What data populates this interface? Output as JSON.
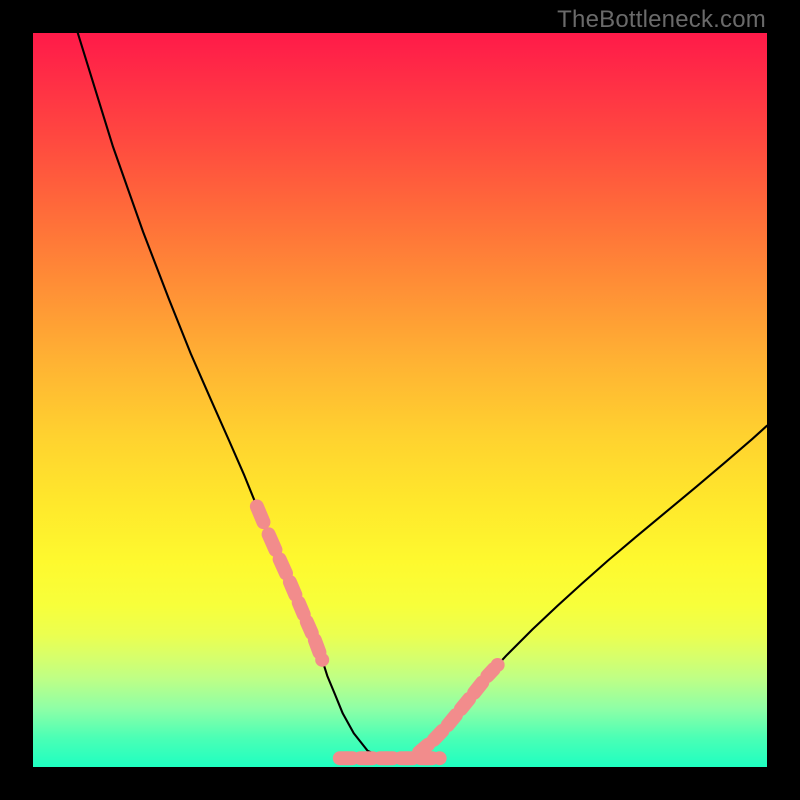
{
  "watermark": {
    "text": "TheBottleneck.com"
  },
  "chart_data": {
    "type": "line",
    "title": "",
    "xlabel": "",
    "ylabel": "",
    "xlim": [
      0,
      100
    ],
    "ylim": [
      0,
      100
    ],
    "grid": false,
    "legend": false,
    "annotations": "V-shaped curve over vertical color gradient; salmon segment overlays near trough",
    "series": [
      {
        "name": "curve",
        "color": "#000000",
        "x": [
          6.1,
          10.9,
          15.0,
          18.5,
          21.5,
          24.3,
          26.7,
          28.8,
          30.5,
          32.1,
          33.6,
          35.0,
          36.2,
          37.3,
          38.4,
          39.4,
          40.1,
          41.1,
          42.2,
          43.7,
          45.6,
          48.4,
          50.6,
          52.6,
          54.6,
          56.5,
          58.3,
          60.1,
          61.9,
          64.5,
          68.1,
          71.5,
          74.8,
          78.3,
          82.2,
          86.3,
          90.4,
          94.4,
          98.0,
          100.0
        ],
        "y": [
          100.0,
          84.5,
          72.9,
          63.8,
          56.3,
          49.9,
          44.5,
          39.7,
          35.5,
          31.7,
          28.3,
          25.2,
          22.4,
          19.8,
          17.3,
          14.6,
          12.4,
          10.0,
          7.3,
          4.6,
          2.2,
          0.9,
          0.9,
          2.0,
          3.7,
          5.7,
          7.9,
          10.1,
          12.4,
          15.2,
          18.8,
          22.0,
          25.0,
          28.1,
          31.4,
          34.8,
          38.2,
          41.6,
          44.7,
          46.5
        ]
      },
      {
        "name": "highlight-left",
        "color": "#f28c8c",
        "thick": true,
        "x": [
          30.5,
          32.1,
          33.6,
          35.0,
          36.2,
          37.3,
          38.4,
          39.4
        ],
        "y": [
          35.5,
          31.7,
          28.3,
          25.2,
          22.4,
          19.8,
          17.3,
          14.6
        ]
      },
      {
        "name": "highlight-right",
        "color": "#f28c8c",
        "thick": true,
        "x": [
          52.6,
          54.6,
          56.5,
          58.3,
          60.1,
          61.9,
          63.3
        ],
        "y": [
          2.0,
          3.7,
          5.7,
          7.9,
          10.1,
          12.4,
          13.9
        ]
      },
      {
        "name": "highlight-floor",
        "color": "#f28c8c",
        "thick": true,
        "x": [
          41.8,
          44.6,
          47.3,
          50.1,
          52.8,
          55.4
        ],
        "y": [
          1.2,
          1.2,
          1.2,
          1.2,
          1.2,
          1.2
        ]
      }
    ]
  }
}
